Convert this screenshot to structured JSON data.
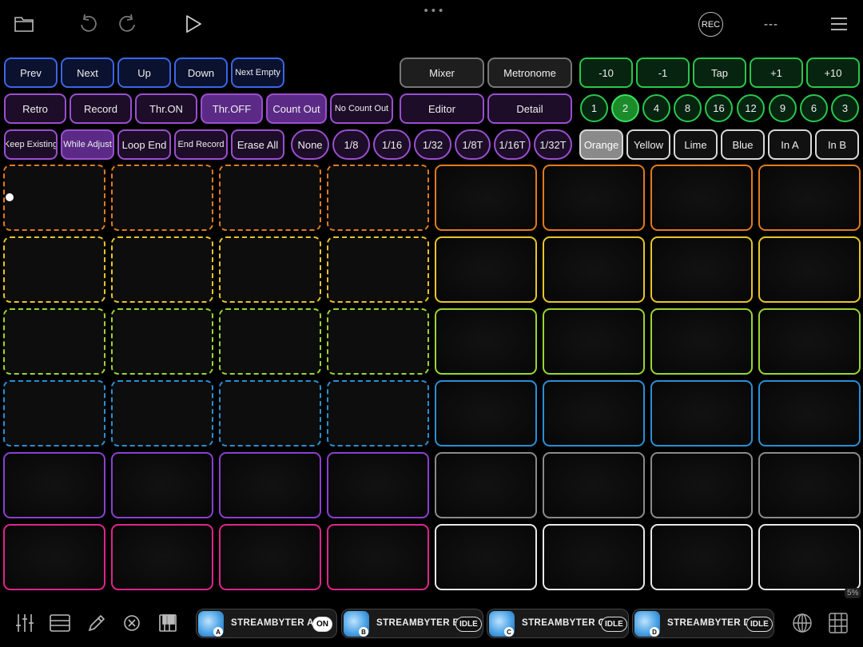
{
  "topbar": {
    "grabber": "•••",
    "rec_label": "REC",
    "status_text": "---",
    "icons": [
      "folder-icon",
      "undo-icon",
      "redo-icon",
      "play-icon",
      "menu-icon"
    ]
  },
  "row1_blue": [
    "Prev",
    "Next",
    "Up",
    "Down",
    "Next Empty"
  ],
  "row1_gray": [
    "Mixer",
    "Metronome"
  ],
  "row1_green": [
    "-10",
    "-1",
    "Tap",
    "+1",
    "+10"
  ],
  "row2_purple": [
    {
      "label": "Retro",
      "on": false
    },
    {
      "label": "Record",
      "on": false
    },
    {
      "label": "Thr.ON",
      "on": false
    },
    {
      "label": "Thr.OFF",
      "on": true
    },
    {
      "label": "Count Out",
      "on": true
    },
    {
      "label": "No Count Out",
      "on": false
    }
  ],
  "row2_gray": [
    "Editor",
    "Detail"
  ],
  "row2_bars": [
    {
      "label": "1",
      "on": false
    },
    {
      "label": "2",
      "on": true
    },
    {
      "label": "4",
      "on": false
    },
    {
      "label": "8",
      "on": false
    },
    {
      "label": "16",
      "on": false
    },
    {
      "label": "12",
      "on": false
    },
    {
      "label": "9",
      "on": false
    },
    {
      "label": "6",
      "on": false
    },
    {
      "label": "3",
      "on": false
    }
  ],
  "row3_purple": [
    {
      "label": "Keep Existing",
      "on": false
    },
    {
      "label": "While Adjust",
      "on": true
    },
    {
      "label": "Loop End",
      "on": false
    },
    {
      "label": "End Record",
      "on": false
    },
    {
      "label": "Erase All",
      "on": false
    }
  ],
  "row3_quant": [
    "None",
    "1/8",
    "1/16",
    "1/32",
    "1/8T",
    "1/16T",
    "1/32T"
  ],
  "row3_white": [
    {
      "label": "Orange",
      "on": true
    },
    {
      "label": "Yellow",
      "on": false
    },
    {
      "label": "Lime",
      "on": false
    },
    {
      "label": "Blue",
      "on": false
    },
    {
      "label": "In A",
      "on": false
    },
    {
      "label": "In B",
      "on": false
    }
  ],
  "pad_rows": [
    {
      "left_color": "#e07a1f",
      "right_color": "#e07a1f",
      "left_dashed": true
    },
    {
      "left_color": "#e6c52a",
      "right_color": "#e6c52a",
      "left_dashed": true
    },
    {
      "left_color": "#9ad433",
      "right_color": "#9ad433",
      "left_dashed": true
    },
    {
      "left_color": "#2a8fd4",
      "right_color": "#2a8fd4",
      "left_dashed": true
    },
    {
      "left_color": "#8a3fd0",
      "right_color": "#8a8a8a",
      "left_dashed": false
    },
    {
      "left_color": "#e0248a",
      "right_color": "#e8e8e8",
      "left_dashed": false
    }
  ],
  "bottombar": {
    "icons": [
      "mixer-sliders-icon",
      "list-icon",
      "pencil-icon",
      "close-circle-icon",
      "piano-icon"
    ],
    "right_icons": [
      "globe-icon",
      "patch-bay-icon"
    ],
    "plugins": [
      {
        "name": "STREAMBYTER A",
        "badge": "A",
        "state": "ON"
      },
      {
        "name": "STREAMBYTER B",
        "badge": "B",
        "state": "IDLE"
      },
      {
        "name": "STREAMBYTER C",
        "badge": "C",
        "state": "IDLE"
      },
      {
        "name": "STREAMBYTER D",
        "badge": "D",
        "state": "IDLE"
      }
    ],
    "cpu": "5%"
  }
}
